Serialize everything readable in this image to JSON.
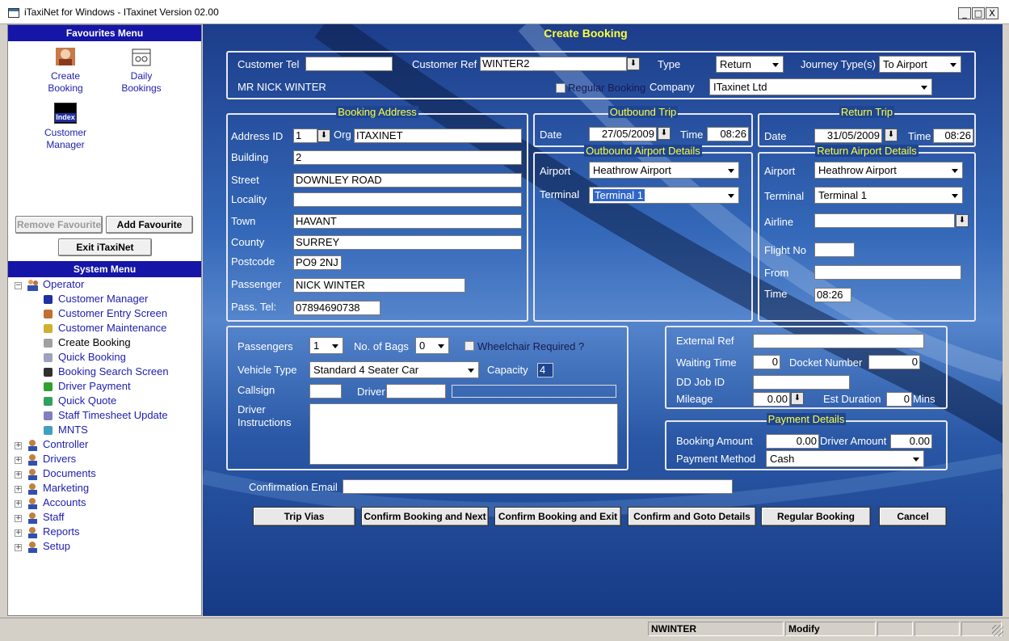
{
  "window": {
    "title": "iTaxiNet for Windows - ITaxinet Version 02.00",
    "min": "_",
    "max": "□",
    "close": "X"
  },
  "favourites": {
    "header": "Favourites Menu",
    "items": [
      {
        "label1": "Create",
        "label2": "Booking",
        "icon": "create-booking-icon"
      },
      {
        "label1": "Daily",
        "label2": "Bookings",
        "icon": "daily-bookings-icon"
      },
      {
        "label1": "Customer",
        "label2": "Manager",
        "icon": "customer-manager-icon",
        "icon_text": "Index"
      }
    ],
    "remove_label": "Remove Favourite",
    "add_label": "Add Favourite",
    "exit_label": "Exit iTaxiNet"
  },
  "system_menu": {
    "header": "System Menu",
    "operator": "Operator",
    "operator_children": [
      "Customer Manager",
      "Customer Entry Screen",
      "Customer Maintenance",
      "Create Booking",
      "Quick Booking",
      "Booking Search Screen",
      "Driver Payment",
      "Quick Quote",
      "Staff Timesheet Update",
      "MNTS"
    ],
    "others": [
      "Controller",
      "Drivers",
      "Documents",
      "Marketing",
      "Accounts",
      "Staff",
      "Reports",
      "Setup"
    ]
  },
  "form": {
    "title": "Create Booking",
    "customer": {
      "tel_label": "Customer Tel",
      "tel": "",
      "ref_label": "Customer Ref",
      "ref": "WINTER2",
      "type_label": "Type",
      "type": "Return",
      "journey_label": "Journey Type(s)",
      "journey": "To Airport",
      "name": "MR NICK WINTER",
      "regular_label": "Regular Booking",
      "company_label": "Company",
      "company": "ITaxinet Ltd"
    },
    "address": {
      "title": "Booking Address",
      "id_label": "Address ID",
      "id": "1",
      "org_label": "Org",
      "org": "ITAXINET",
      "building_label": "Building",
      "building": "2",
      "street_label": "Street",
      "street": "DOWNLEY ROAD",
      "locality_label": "Locality",
      "locality": "",
      "town_label": "Town",
      "town": "HAVANT",
      "county_label": "County",
      "county": "SURREY",
      "postcode_label": "Postcode",
      "postcode": "PO9 2NJ",
      "passenger_label": "Passenger",
      "passenger": "NICK WINTER",
      "ptel_label": "Pass. Tel:",
      "ptel": "07894690738"
    },
    "outbound": {
      "title": "Outbound Trip",
      "date_label": "Date",
      "date": "27/05/2009",
      "time_label": "Time",
      "time": "08:26",
      "airport_title": "Outbound Airport Details",
      "airport_label": "Airport",
      "airport": "Heathrow Airport",
      "terminal_label": "Terminal",
      "terminal": "Terminal 1"
    },
    "return_trip": {
      "title": "Return Trip",
      "date_label": "Date",
      "date": "31/05/2009",
      "time_label": "Time",
      "time": "08:26",
      "airport_title": "Return Airport Details",
      "airport_label": "Airport",
      "airport": "Heathrow Airport",
      "terminal_label": "Terminal",
      "terminal": "Terminal 1",
      "airline_label": "Airline",
      "airline": "",
      "flight_label": "Flight No",
      "flight": "",
      "from_label": "From",
      "from": "",
      "rtime_label": "Time",
      "rtime": "08:26"
    },
    "vehicle": {
      "passengers_label": "Passengers",
      "passengers": "1",
      "bags_label": "No. of Bags",
      "bags": "0",
      "wheelchair_label": "Wheelchair Required ?",
      "type_label": "Vehicle Type",
      "type": "Standard 4 Seater Car",
      "capacity_label": "Capacity",
      "capacity": "4",
      "callsign_label": "Callsign",
      "callsign": "",
      "driver_label": "Driver",
      "driver": "",
      "instr_label1": "Driver",
      "instr_label2": "Instructions",
      "instructions": ""
    },
    "extra": {
      "ext_label": "External Ref",
      "ext": "",
      "wait_label": "Waiting Time",
      "wait": "0",
      "docket_label": "Docket Number",
      "docket": "0",
      "ddjob_label": "DD Job ID",
      "ddjob": "",
      "mileage_label": "Mileage",
      "mileage": "0.00",
      "duration_label": "Est Duration",
      "duration": "0",
      "duration_unit": "Mins"
    },
    "payment": {
      "title": "Payment Details",
      "booking_label": "Booking Amount",
      "booking": "0.00",
      "driver_label": "Driver Amount",
      "driver": "0.00",
      "method_label": "Payment Method",
      "method": "Cash"
    },
    "email_label": "Confirmation Email",
    "email": "",
    "buttons": [
      "Trip Vias",
      "Confirm Booking and Next",
      "Confirm Booking and Exit",
      "Confirm and Goto Details",
      "Regular Booking",
      "Cancel"
    ]
  },
  "status": {
    "user": "NWINTER",
    "mode": "Modify"
  }
}
